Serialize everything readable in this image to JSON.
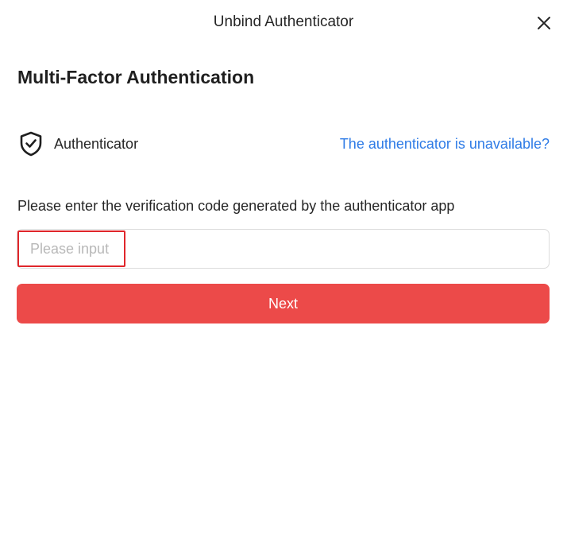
{
  "dialog": {
    "title": "Unbind Authenticator",
    "close_icon": "close-icon"
  },
  "main": {
    "heading": "Multi-Factor Authentication",
    "method": {
      "icon": "shield-check-icon",
      "label": "Authenticator",
      "unavailable_link": "The authenticator is unavailable?"
    },
    "instruction": "Please enter the verification code generated by the authenticator app",
    "code_input": {
      "value": "",
      "placeholder": "Please input"
    },
    "next_label": "Next"
  },
  "colors": {
    "link": "#2e7be6",
    "primary_button": "#ec4a49",
    "focus_border": "#e0262b"
  }
}
